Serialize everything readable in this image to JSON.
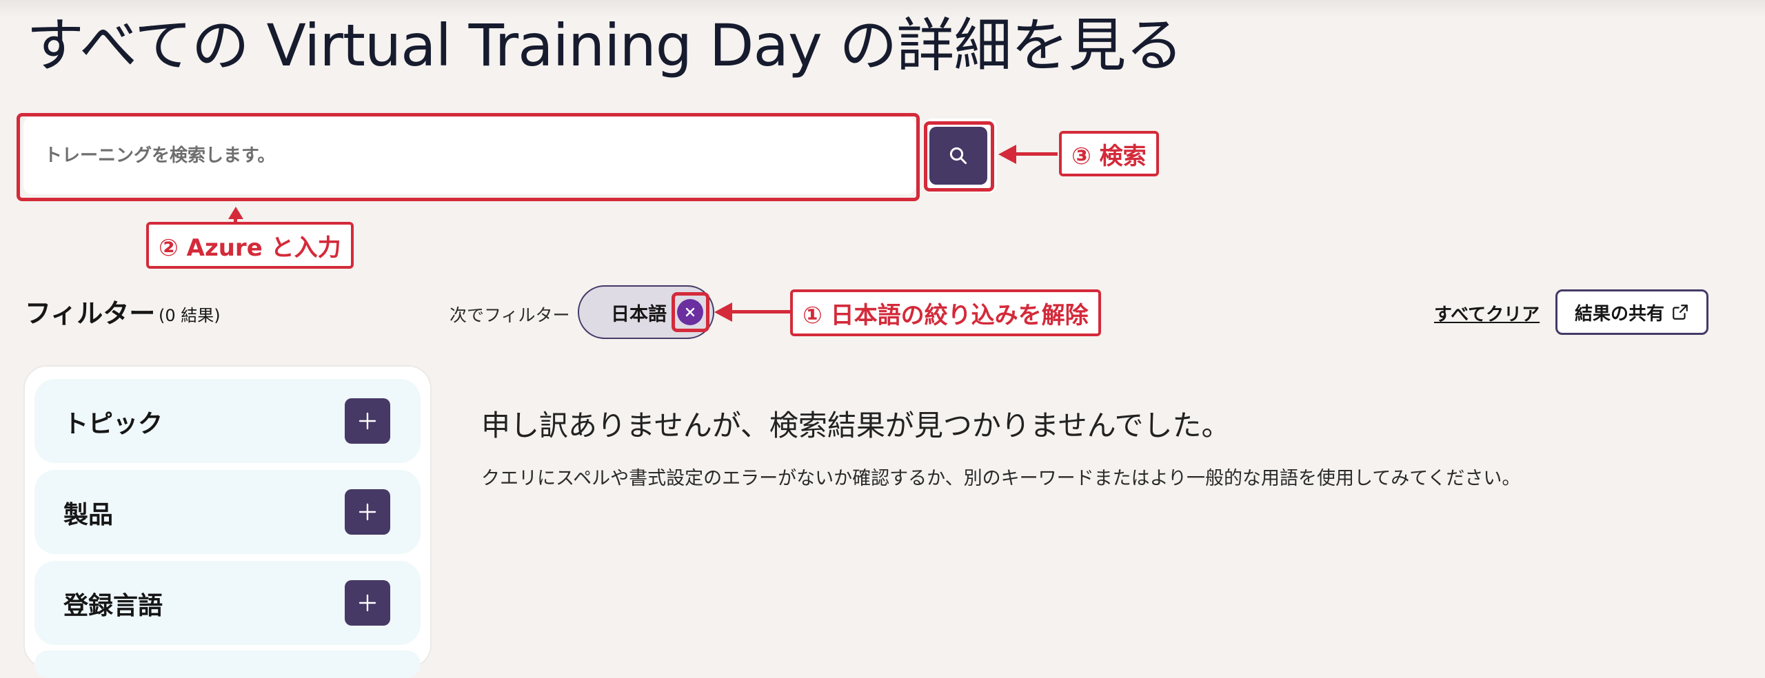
{
  "page": {
    "title": "すべての Virtual Training Day の詳細を見る"
  },
  "search": {
    "placeholder": "トレーニングを検索します。"
  },
  "annotations": {
    "step1": "① 日本語の絞り込みを解除",
    "step2": "② Azure と入力",
    "step3": "③ 検索"
  },
  "filters": {
    "heading": "フィルター",
    "result_count": "(0 結果)",
    "filter_by_label": "次でフィルター",
    "active_chip": "日本語",
    "clear_all": "すべてクリア",
    "share": "結果の共有"
  },
  "sidebar": {
    "items": [
      {
        "label": "トピック"
      },
      {
        "label": "製品"
      },
      {
        "label": "登録言語"
      }
    ]
  },
  "results": {
    "empty_heading": "申し訳ありませんが、検索結果が見つかりませんでした。",
    "empty_help": "クエリにスペルや書式設定のエラーがないか確認するか、別のキーワードまたはより一般的な用語を使用してみてください。"
  },
  "colors": {
    "accent": "#463966",
    "annotation": "#d42a3a",
    "chip_remove": "#6b2fa0"
  },
  "icons": [
    "search-icon",
    "close-icon",
    "plus-icon",
    "share-icon"
  ]
}
